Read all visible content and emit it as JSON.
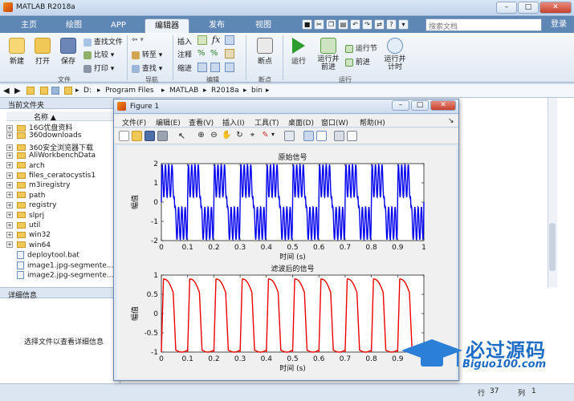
{
  "app": {
    "title": "MATLAB R2018a"
  },
  "tabs": [
    "主页",
    "绘图",
    "APP",
    "编辑器",
    "发布",
    "视图"
  ],
  "active_tab": "编辑器",
  "search": {
    "placeholder": "搜索文档"
  },
  "login": "登录",
  "ribbon": {
    "file": {
      "new": "新建",
      "open": "打开",
      "save": "保存",
      "find_files": "查找文件",
      "compare": "比较",
      "print": "打印",
      "group": "文件"
    },
    "nav": {
      "goto": "转至",
      "find": "查找",
      "group": "导航"
    },
    "edit": {
      "insert": "插入",
      "comment": "注释",
      "indent": "缩进",
      "group": "编辑"
    },
    "breakpoints": {
      "label": "断点",
      "group": "断点"
    },
    "run": {
      "run": "运行",
      "run_advance": "运行并\n前进",
      "run_section": "运行节",
      "advance": "前进",
      "run_time": "运行并\n计时",
      "group": "运行"
    }
  },
  "address": [
    "D:",
    "Program Files",
    "MATLAB",
    "R2018a",
    "bin"
  ],
  "current_folder": {
    "header": "当前文件夹",
    "column": "名称",
    "items": [
      {
        "name": "16G优盘资料",
        "type": "folder"
      },
      {
        "name": "360downloads",
        "type": "folder"
      },
      {
        "name": "360安全浏览器下载",
        "type": "folder"
      },
      {
        "name": "AliWorkbenchData",
        "type": "folder"
      },
      {
        "name": "arch",
        "type": "folder"
      },
      {
        "name": "files_ceratocystis1",
        "type": "folder"
      },
      {
        "name": "m3iregistry",
        "type": "folder"
      },
      {
        "name": "path",
        "type": "folder"
      },
      {
        "name": "registry",
        "type": "folder"
      },
      {
        "name": "slprj",
        "type": "folder"
      },
      {
        "name": "util",
        "type": "folder"
      },
      {
        "name": "win32",
        "type": "folder"
      },
      {
        "name": "win64",
        "type": "folder"
      },
      {
        "name": "deploytool.bat",
        "type": "file"
      },
      {
        "name": "image1.jpg-segmente...",
        "type": "file"
      },
      {
        "name": "image2.jpg-segmente...",
        "type": "file"
      }
    ]
  },
  "details": {
    "header": "详细信息",
    "text": "选择文件以查看详细信息"
  },
  "status": {
    "row_label": "行",
    "row": "37",
    "col_label": "列",
    "col": "1"
  },
  "figure": {
    "title": "Figure 1",
    "menu": [
      "文件(F)",
      "编辑(E)",
      "查看(V)",
      "插入(I)",
      "工具(T)",
      "桌面(D)",
      "窗口(W)",
      "帮助(H)"
    ]
  },
  "chart_data": [
    {
      "type": "line",
      "title": "原始信号",
      "xlabel": "时间 (s)",
      "ylabel": "幅值",
      "xlim": [
        0,
        1
      ],
      "ylim": [
        -2,
        2
      ],
      "xticks": [
        "0",
        "0.1",
        "0.2",
        "0.3",
        "0.4",
        "0.5",
        "0.6",
        "0.7",
        "0.8",
        "0.9",
        "1"
      ],
      "yticks": [
        "-2",
        "-1",
        "0",
        "1",
        "2"
      ],
      "series": [
        {
          "color": "#0000ee",
          "signal": "sum of 10 Hz square-like wave and 80 Hz sinusoid",
          "fundamental_hz": 10,
          "noise_hz": 80,
          "amplitude_range": [
            -2,
            2
          ]
        }
      ]
    },
    {
      "type": "line",
      "title": "滤波后的信号",
      "xlabel": "时间 (s)",
      "ylabel": "幅值",
      "xlim": [
        0,
        1
      ],
      "ylim": [
        -1,
        1
      ],
      "xticks": [
        "0",
        "0.1",
        "0.2",
        "0.3",
        "0.4",
        "0.5",
        "0.6",
        "0.7",
        "0.8",
        "0.9",
        "1"
      ],
      "yticks": [
        "-1",
        "-0.5",
        "0",
        "0.5",
        "1"
      ],
      "series": [
        {
          "color": "#ee0000",
          "signal": "filtered 10 Hz periodic waveform",
          "fundamental_hz": 10,
          "amplitude_range": [
            -1,
            1
          ]
        }
      ]
    }
  ],
  "watermark": {
    "main": "必过源码",
    "sub": "Biguo100.com"
  }
}
